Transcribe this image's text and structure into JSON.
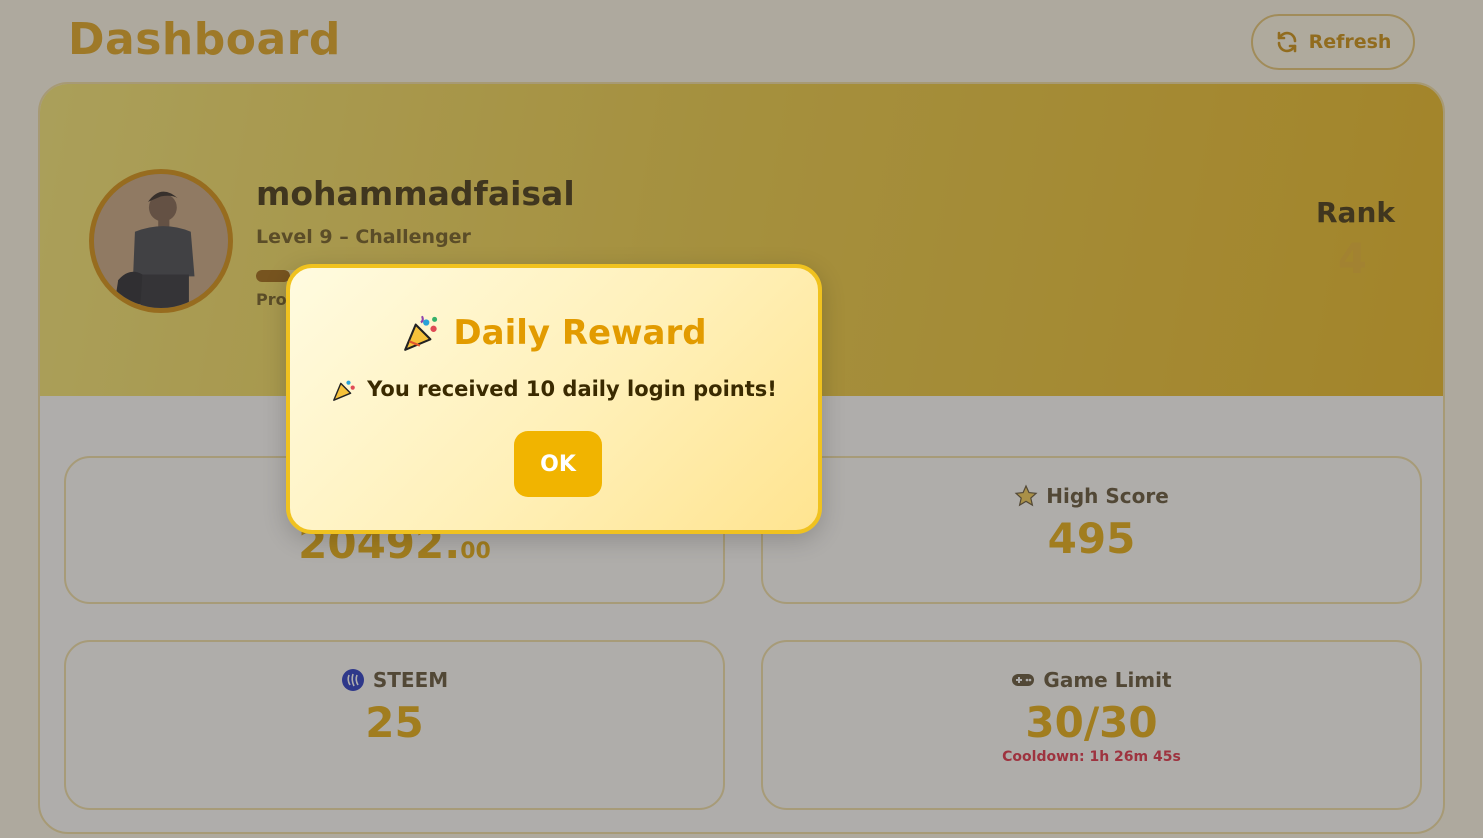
{
  "header": {
    "title": "Dashboard",
    "refresh_label": "Refresh"
  },
  "profile": {
    "username": "mohammadfaisal",
    "level_text": "Level 9 – Challenger",
    "progress_label": "Pro",
    "progress_fraction": 0.13,
    "rank_label": "Rank",
    "rank_value": "4"
  },
  "stats": {
    "points": {
      "value_main": "20492.",
      "value_decimals": "00"
    },
    "high_score": {
      "label": "High Score",
      "value": "495",
      "icon": "star-icon"
    },
    "steem": {
      "label": "STEEM",
      "value": "25",
      "icon": "steem-logo-icon"
    },
    "game_limit": {
      "label": "Game Limit",
      "value": "30/30",
      "cooldown": "Cooldown: 1h 26m 45s",
      "icon": "gamepad-icon"
    }
  },
  "modal": {
    "title": "Daily Reward",
    "message": "You received 10 daily login points!",
    "ok_label": "OK",
    "icon": "party-popper-icon"
  },
  "colors": {
    "accent": "#e7a800",
    "hero_gradient_start": "#f7e56a",
    "hero_gradient_end": "#e9b514",
    "cooldown": "#e0243a",
    "modal_border": "#f0c21f"
  }
}
